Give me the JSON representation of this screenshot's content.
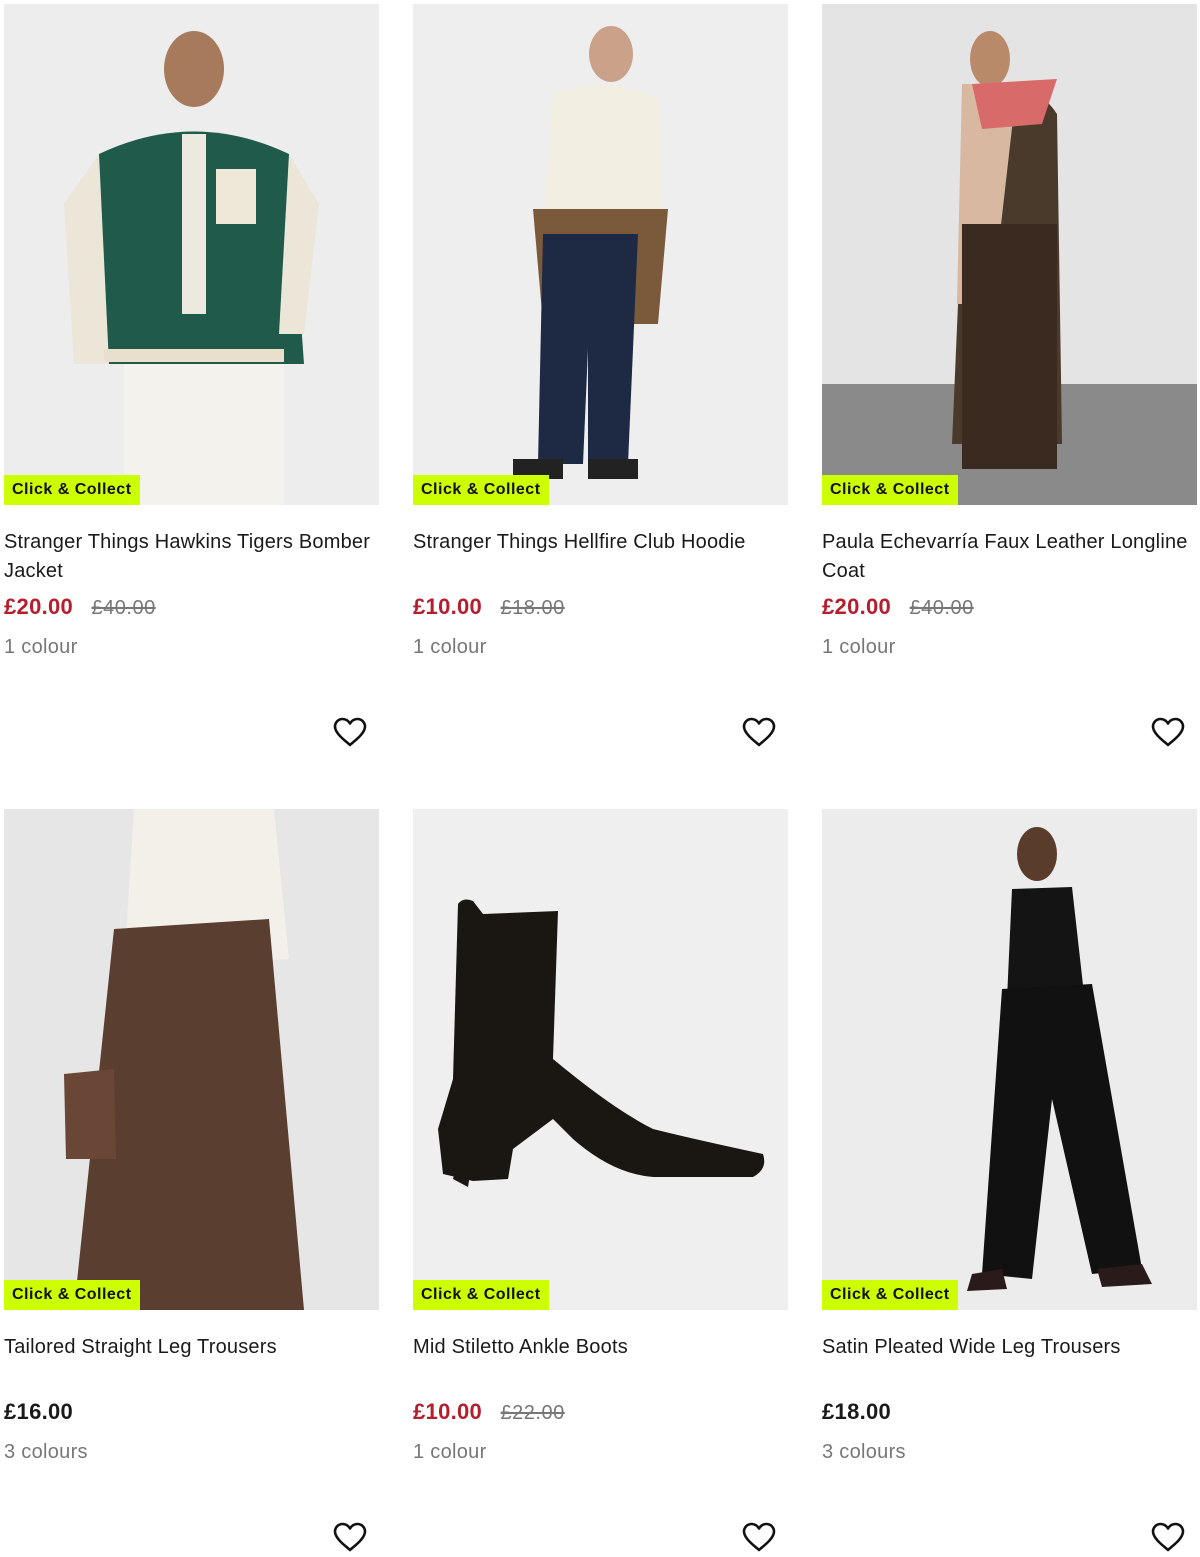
{
  "badge_label": "Click & Collect",
  "colors": {
    "sale": "#b41e2d",
    "badge_bg": "#ccff00",
    "muted": "#777777"
  },
  "products": [
    {
      "title": "Stranger Things Hawkins Tigers Bomber Jacket",
      "price": "£20.00",
      "was_price": "£40.00",
      "colours": "1 colour",
      "on_sale": true
    },
    {
      "title": "Stranger Things Hellfire Club Hoodie",
      "price": "£10.00",
      "was_price": "£18.00",
      "colours": "1 colour",
      "on_sale": true
    },
    {
      "title": "Paula Echevarría Faux Leather Longline Coat",
      "price": "£20.00",
      "was_price": "£40.00",
      "colours": "1 colour",
      "on_sale": true
    },
    {
      "title": "Tailored Straight Leg Trousers",
      "price": "£16.00",
      "colours": "3 colours",
      "on_sale": false
    },
    {
      "title": "Mid Stiletto Ankle Boots",
      "price": "£10.00",
      "was_price": "£22.00",
      "colours": "1 colour",
      "on_sale": true
    },
    {
      "title": "Satin Pleated Wide Leg Trousers",
      "price": "£18.00",
      "colours": "3 colours",
      "on_sale": false
    }
  ],
  "icons": {
    "wishlist": "heart-outline-icon"
  }
}
